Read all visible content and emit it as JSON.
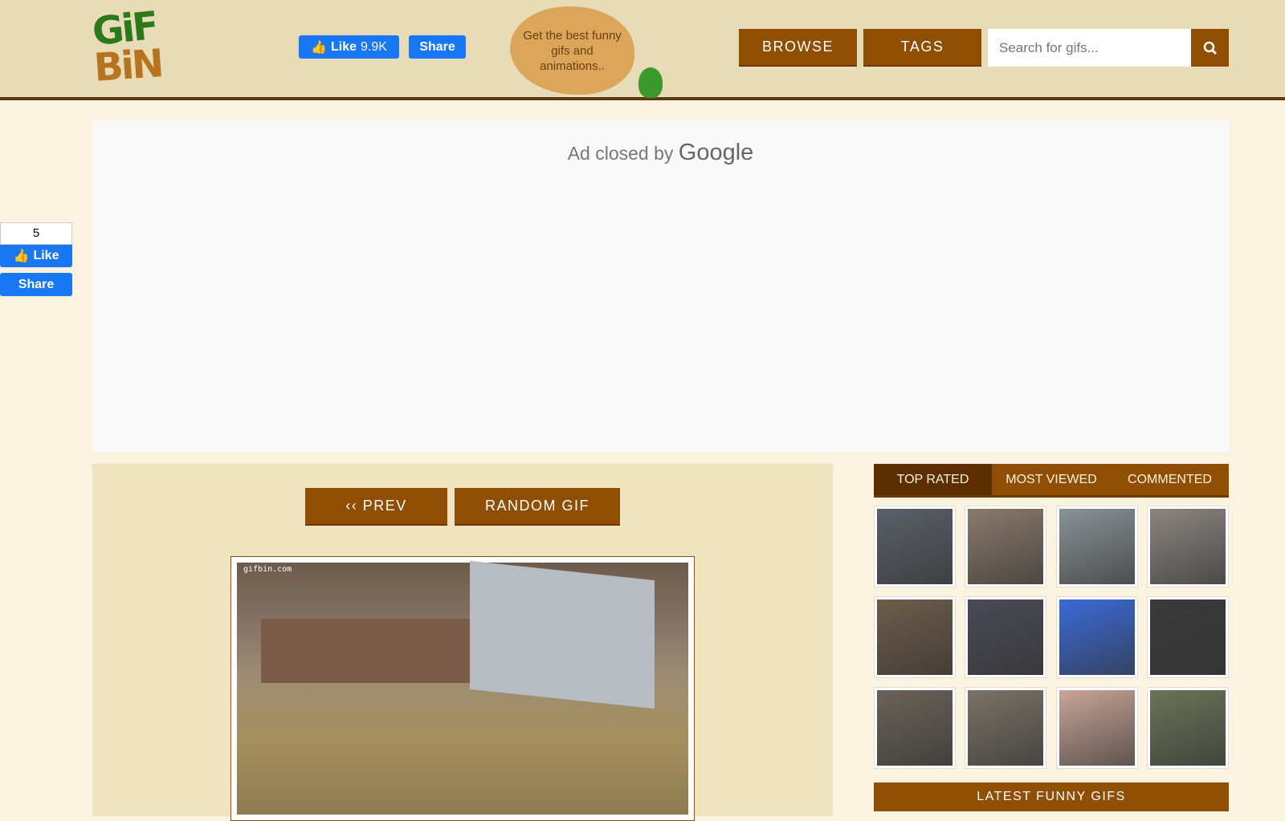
{
  "header": {
    "logo_text": "GIF BIN",
    "like_label": "Like",
    "like_count": "9.9K",
    "share_label": "Share",
    "tagline": "Get the best funny gifs and animations..",
    "browse_label": "BROWSE",
    "tags_label": "TAGS",
    "search_placeholder": "Search for gifs..."
  },
  "ad": {
    "text": "Ad closed by",
    "brand": "Google"
  },
  "side_social": {
    "count": "5",
    "like_label": "Like",
    "share_label": "Share"
  },
  "nav": {
    "prev_label": "‹‹ PREV",
    "random_label": "RANDOM GIF"
  },
  "gif": {
    "watermark": "gifbin.com"
  },
  "sidebar": {
    "tabs": [
      {
        "label": "TOP RATED"
      },
      {
        "label": "MOST VIEWED"
      },
      {
        "label": "COMMENTED"
      }
    ],
    "thumbs": [
      "#5a6068",
      "#8a7a6a",
      "#8a9296",
      "#8b8580",
      "#6e5c48",
      "#4a4a55",
      "#3a6ad8",
      "#3a3a3a",
      "#6a6258",
      "#7a7266",
      "#c9a596",
      "#6a7456"
    ],
    "latest_label": "LATEST FUNNY GIFS"
  }
}
